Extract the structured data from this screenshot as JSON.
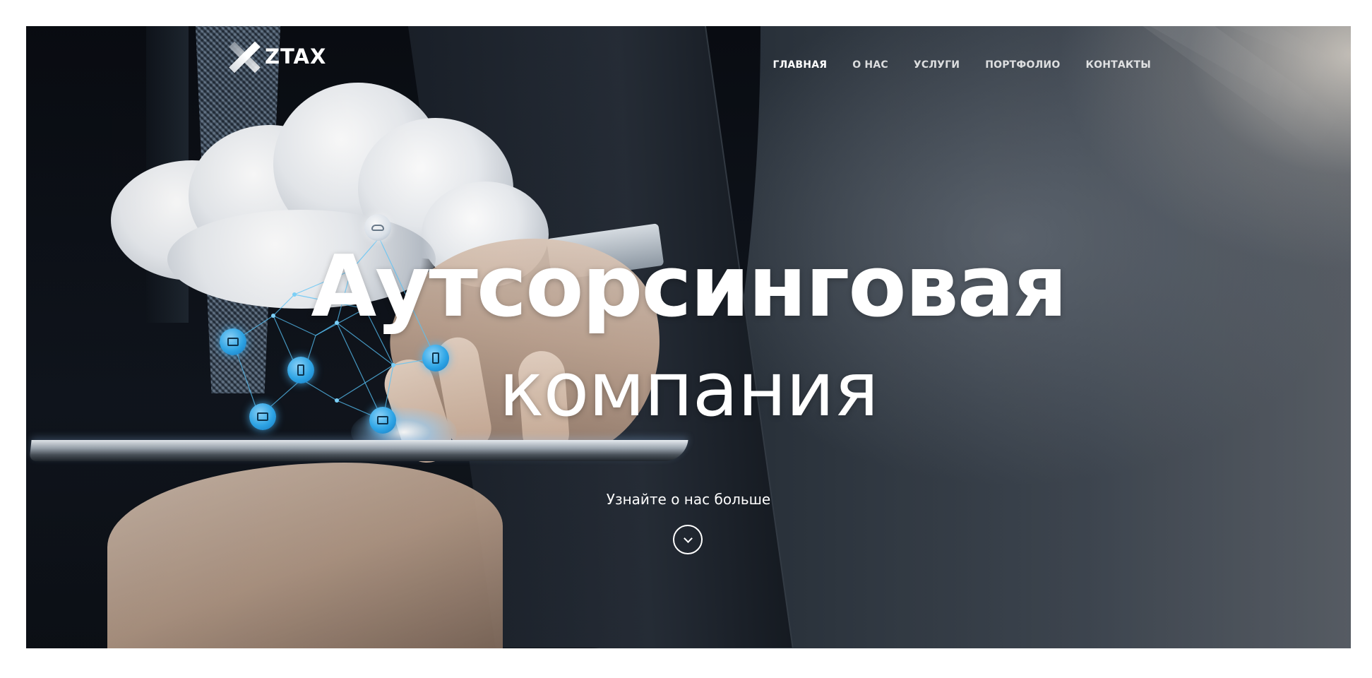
{
  "brand": {
    "logo_text": "ZTAX",
    "logo_icon": "x-logo-icon"
  },
  "nav": {
    "items": [
      {
        "label": "ГЛАВНАЯ",
        "active": true
      },
      {
        "label": "О НАС",
        "active": false
      },
      {
        "label": "УСЛУГИ",
        "active": false
      },
      {
        "label": "ПОРТФОЛИО",
        "active": false
      },
      {
        "label": "КОНТАКТЫ",
        "active": false
      }
    ]
  },
  "hero": {
    "headline_bold": "Аутсорсинговая",
    "headline_light": "компания",
    "cta_text": "Узнайте о нас больше",
    "scroll_icon": "chevron-down-icon"
  },
  "colors": {
    "text": "#ffffff",
    "node_accent": "#2fa9ec",
    "background_dark": "#0b0f16"
  }
}
